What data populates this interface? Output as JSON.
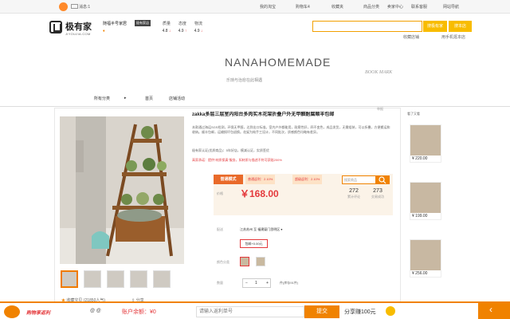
{
  "topbar": {
    "messages": "消息:1",
    "links": [
      "我的淘宝",
      "购物车4",
      "收藏夹",
      "商品分类",
      "卖家中心",
      "联系客服",
      "网站导航"
    ]
  },
  "header": {
    "logo_name": "极有家",
    "logo_sub": "JIYOUJIA.COM",
    "shop_name": "随福半号家居",
    "shop_badge": "极有家店",
    "shop_stars": "♦",
    "ratings": [
      {
        "label": "质量",
        "value": "4.8",
        "dir": "↓"
      },
      {
        "label": "态度",
        "value": "4.9",
        "dir": "↑"
      },
      {
        "label": "物流",
        "value": "4.9",
        "dir": "↓"
      }
    ],
    "search_placeholder": "",
    "search_all_label": "搜极有家",
    "search_shop_label": "搜本店",
    "links": [
      "收藏店铺",
      "用手机逛本店"
    ]
  },
  "banner": {
    "title": "NANAHOMEMADE",
    "subtitle": "乐琐与治愈在此相遇",
    "mark": "BOOK MARK"
  },
  "nav": {
    "items": [
      "所有分类",
      "▸",
      "首页",
      "店铺活动"
    ]
  },
  "breadcrumb": "举报",
  "product": {
    "title": "zakka多层三层室内阳台多肉实木花架折叠户外无甲醛耐腐顺丰包邮",
    "description": "本款通过海运SGS检测，环保无甲醛，达到出口标准。室内户外都能用，耐腐性好，四不变色，成品发货，无需组装，可以折叠，方便搬运和收纳。顺丰包邮，运输损坏包退换。花架为纯手工设计，不同批次，质感颜色均略有差异。",
    "join": "极有家认证(优质商品)：5年好店，模减认证，实质签优",
    "warning": "高家承诺：提供“材质保真”服务，如材质与描述不符可获赔200%",
    "promo_tabs": [
      "普通模式",
      "普通返利：2.10%",
      "超级返利：2.10%"
    ],
    "promo_search_placeholder": "搜索商品",
    "price_label": "价格",
    "price": "￥168.00",
    "stats": [
      {
        "value": "272",
        "label": "累计评论"
      },
      {
        "value": "273",
        "label": "交易成功"
      }
    ],
    "shipping_label": "配送",
    "shipping_value": "江苏苏州 至  福建厦门思明区 ▾",
    "shipping_option": "包邮+0.00元",
    "color_label": "颜色分类",
    "quantity_label": "数量",
    "quantity": "1",
    "stock": "件(库存91件)",
    "favorites": "收藏宝贝 (21850人气)",
    "share": "分享"
  },
  "sidebar": {
    "title": "看了又看",
    "items": [
      {
        "price": "¥ 220.00"
      },
      {
        "price": "¥ 199.00"
      },
      {
        "price": "¥ 256.00"
      }
    ]
  },
  "bottombar": {
    "rebate_label": "购物享返利",
    "at_label": "@ @",
    "balance": "账户余额：¥0",
    "order_placeholder": "请输入返利单号",
    "submit_label": "提交",
    "share_earn": "分享赚100元"
  },
  "colors": {
    "accent": "#f08200",
    "price_red": "#e4393c",
    "search_yellow": "#f8bc00"
  }
}
